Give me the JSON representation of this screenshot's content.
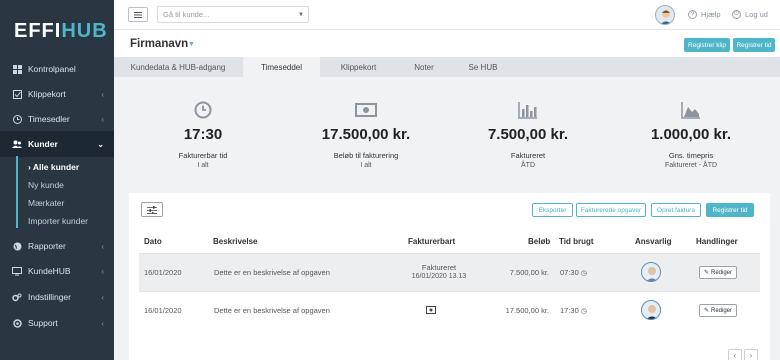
{
  "logo": {
    "part1": "EFFI",
    "part2": "HUB"
  },
  "sidebar": {
    "items": [
      {
        "label": "Kontrolpanel"
      },
      {
        "label": "Klippekort"
      },
      {
        "label": "Timesedler"
      },
      {
        "label": "Kunder"
      },
      {
        "label": "Rapporter"
      },
      {
        "label": "KundeHUB"
      },
      {
        "label": "Indstillinger"
      },
      {
        "label": "Support"
      }
    ],
    "sub_items": [
      {
        "label": "Alle kunder"
      },
      {
        "label": "Ny kunde"
      },
      {
        "label": "Mærkater"
      },
      {
        "label": "Importer kunder"
      }
    ]
  },
  "topbar": {
    "search_placeholder": "Gå til kunde...",
    "help": "Hjælp",
    "logout": "Log ud"
  },
  "header": {
    "company": "Firmanavn",
    "btn_clip": "Registrer klip",
    "btn_time": "Registrer tid"
  },
  "tabs": [
    {
      "label": "Kundedata & HUB-adgang"
    },
    {
      "label": "Timeseddel"
    },
    {
      "label": "Klippekort"
    },
    {
      "label": "Noter"
    },
    {
      "label": "Se HUB"
    }
  ],
  "stats": [
    {
      "value": "17:30",
      "label": "Fakturerbar tid",
      "sub": "I alt",
      "icon": "clock-icon"
    },
    {
      "value": "17.500,00 kr.",
      "label": "Beløb til fakturering",
      "sub": "I alt",
      "icon": "money-icon"
    },
    {
      "value": "7.500,00 kr.",
      "label": "Faktureret",
      "sub": "ÅTD",
      "icon": "bar-chart-icon"
    },
    {
      "value": "1.000,00 kr.",
      "label": "Gns. timepris",
      "sub": "Faktureret - ÅTD",
      "icon": "area-chart-icon"
    }
  ],
  "toolbar": {
    "export": "Eksporter",
    "invoiced": "Fakturerede opgaver",
    "create_invoice": "Opret faktura",
    "register_time": "Registrer tid"
  },
  "table": {
    "headers": [
      "Dato",
      "Beskrivelse",
      "Fakturerbart",
      "Beløb",
      "Tid brugt",
      "Ansvarlig",
      "Handlinger"
    ],
    "rows": [
      {
        "date": "16/01/2020",
        "desc": "Dette er en beskrivelse af opgaven",
        "billable_status": "Faktureret",
        "billable_date": "16/01/2020 13.13",
        "amount": "7.500,00 kr.",
        "time": "07:30",
        "action": "Rediger"
      },
      {
        "date": "16/01/2020",
        "desc": "Dette er en beskrivelse af opgaven",
        "billable_status": "",
        "billable_date": "",
        "amount": "17.500,00 kr.",
        "time": "17:30",
        "action": "Rediger"
      }
    ]
  },
  "pager": {
    "prev": "‹",
    "next": "›"
  },
  "colors": {
    "accent": "#4fb6c9",
    "sidebar": "#2b3643"
  }
}
